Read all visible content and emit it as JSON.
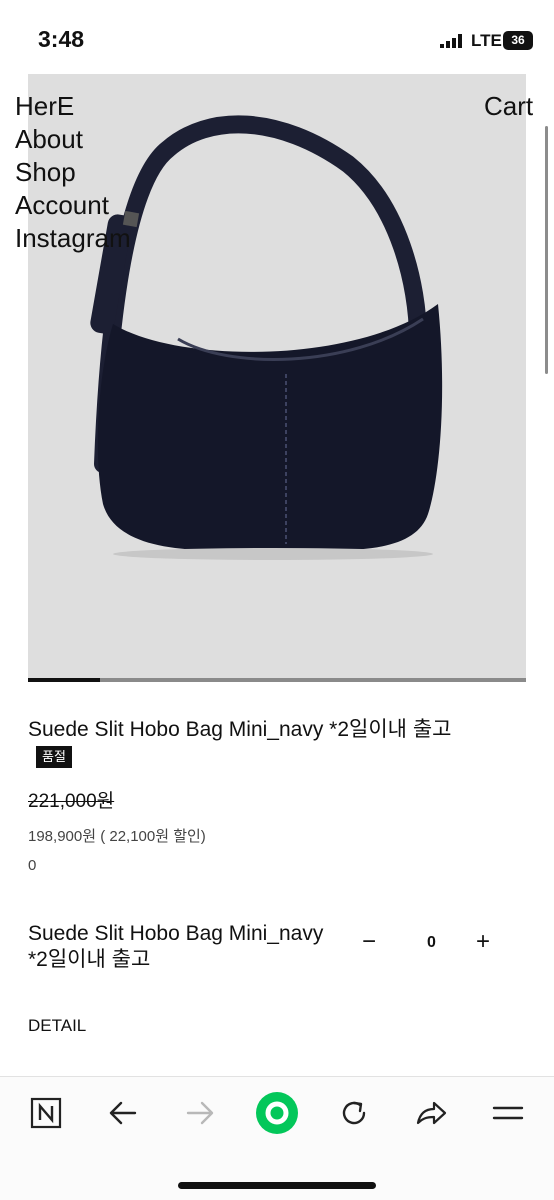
{
  "status_bar": {
    "time": "3:48",
    "network": "LTE",
    "battery": "36"
  },
  "nav": {
    "brand": "HerE",
    "items": [
      "About",
      "Shop",
      "Account",
      "Instagram"
    ],
    "cart": "Cart"
  },
  "gallery": {
    "progress": 0.145
  },
  "product": {
    "title": "Suede Slit Hobo Bag Mini_navy *2일이내 출고",
    "badge": "품절",
    "original_price": "221,000원",
    "sale_price": "198,900원 ( 22,100원 할인)",
    "points": "0"
  },
  "option": {
    "name": "Suede Slit Hobo Bag Mini_navy *2일이내 출고",
    "minus": "−",
    "quantity": "0",
    "plus": "+"
  },
  "detail": {
    "heading": "DETAIL"
  },
  "toolbar": {
    "buttons": [
      "naver-n-icon",
      "back-arrow-icon",
      "forward-arrow-icon",
      "home-circle-icon",
      "refresh-icon",
      "share-icon",
      "menu-icon"
    ],
    "accent": "#03c75a"
  }
}
